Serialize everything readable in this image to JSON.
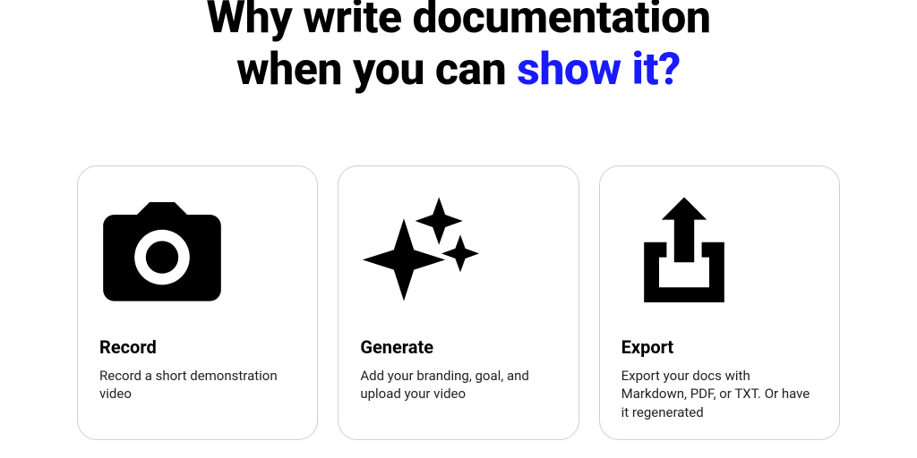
{
  "hero": {
    "line1": "Why write documentation",
    "line2_prefix": "when you can ",
    "line2_accent": "show it?"
  },
  "cards": [
    {
      "title": "Record",
      "desc": "Record a short demonstration video"
    },
    {
      "title": "Generate",
      "desc": "Add your branding, goal, and upload your video"
    },
    {
      "title": "Export",
      "desc": "Export your docs with Markdown, PDF, or TXT. Or have it regenerated"
    }
  ]
}
